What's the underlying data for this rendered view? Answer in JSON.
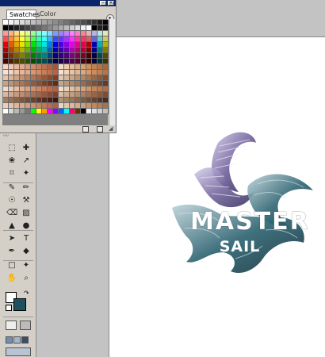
{
  "palette": {
    "tabs": [
      "Swatches",
      "Color"
    ],
    "active_tab": "Swatches",
    "titlebar_buttons": [
      "–",
      "×"
    ],
    "menu_glyph": "▸",
    "row_colors": [
      [
        "#ffffff",
        "#f2f2f2",
        "#e6e6e6",
        "#d9d9d9",
        "#cccccc",
        "#bfbfbf",
        "#b3b3b3",
        "#a6a6a6",
        "#999999",
        "#8c8c8c",
        "#808080",
        "#737373",
        "#666666",
        "#595959",
        "#4d4d4d",
        "#404040",
        "#333333",
        "#1a1a1a",
        "#000000"
      ],
      [
        "#000000",
        "#111111",
        "#222222",
        "#333333",
        "#444444",
        "#555555",
        "#666666",
        "#777777",
        "#888888",
        "#999999",
        "#aaaaaa",
        "#bbbbbb",
        "#cccccc",
        "#dddddd",
        "#eeeeee",
        "#ffffff",
        "#000000",
        "#202020",
        "#101010"
      ],
      [
        "#ff9999",
        "#ffb380",
        "#ffd980",
        "#ffff80",
        "#d9ff80",
        "#99ff99",
        "#80ffd9",
        "#80ffff",
        "#80d9ff",
        "#8099ff",
        "#9980ff",
        "#c080ff",
        "#ff80ff",
        "#ff80c0",
        "#ff8099",
        "#e6b3b3",
        "#b3b3e6",
        "#b3e6e6",
        "#e6e6b3"
      ],
      [
        "#ff4d4d",
        "#ff8c33",
        "#ffc433",
        "#ffff33",
        "#b3ff33",
        "#4dff4d",
        "#33ffb3",
        "#33ffff",
        "#33b3ff",
        "#334dff",
        "#6633ff",
        "#a633ff",
        "#ff33ff",
        "#ff33a6",
        "#ff3366",
        "#cc6666",
        "#6666cc",
        "#66cccc",
        "#cccc66"
      ],
      [
        "#e60000",
        "#e65c00",
        "#e6a800",
        "#e6e600",
        "#80e600",
        "#00e600",
        "#00e680",
        "#00e6e6",
        "#0080e6",
        "#0000e6",
        "#4d00e6",
        "#8c00e6",
        "#e600e6",
        "#e6008c",
        "#e6004d",
        "#b30000",
        "#0000b3",
        "#00b3b3",
        "#b3b300"
      ],
      [
        "#b30000",
        "#b34700",
        "#b38300",
        "#b3b300",
        "#63b300",
        "#00b300",
        "#00b363",
        "#00b3b3",
        "#0063b3",
        "#0000b3",
        "#3b00b3",
        "#6b00b3",
        "#b300b3",
        "#b3006b",
        "#b3003b",
        "#800000",
        "#000080",
        "#008080",
        "#808000"
      ],
      [
        "#800000",
        "#803300",
        "#805e00",
        "#808000",
        "#478000",
        "#008000",
        "#008047",
        "#008080",
        "#004780",
        "#000080",
        "#2b0080",
        "#4d0080",
        "#800080",
        "#80004d",
        "#80002b",
        "#4d0000",
        "#00004d",
        "#004d4d",
        "#4d4d00"
      ],
      [
        "#4d0000",
        "#4d1f00",
        "#4d3800",
        "#4d4d00",
        "#2b4d00",
        "#004d00",
        "#004d2b",
        "#004d4d",
        "#002b4d",
        "#00004d",
        "#1a004d",
        "#2e004d",
        "#4d004d",
        "#4d002e",
        "#4d001a",
        "#330000",
        "#000033",
        "#003333",
        "#333300"
      ],
      [
        "#f5d6c6",
        "#f0c8b4",
        "#e8b9a1",
        "#e0aa8e",
        "#d69b7d",
        "#cc8c6c",
        "#c27e5e",
        "#b87050",
        "#ad6344",
        "#a35639",
        "#f2dcc7",
        "#ebccb0",
        "#e3bc99",
        "#dbad84",
        "#d39e70",
        "#c9905f",
        "#bf8250",
        "#b47443",
        "#a96737"
      ],
      [
        "#fae3d3",
        "#f5d4bf",
        "#efc5ab",
        "#e9b697",
        "#e3a784",
        "#dd9872",
        "#d68a62",
        "#cf7c53",
        "#c86e45",
        "#c16139",
        "#f7e2d1",
        "#f1d3bb",
        "#ebc4a5",
        "#e5b690",
        "#dfa77c",
        "#d9996a",
        "#d28b5a",
        "#cb7e4b",
        "#c4713e"
      ],
      [
        "#e6c2a6",
        "#dbb293",
        "#d0a281",
        "#c59270",
        "#ba8360",
        "#af7451",
        "#a46643",
        "#995837",
        "#8e4b2c",
        "#833f22",
        "#e2c6ad",
        "#d6b699",
        "#caa686",
        "#be9674",
        "#b28763",
        "#a67853",
        "#9a6a45",
        "#8e5c38",
        "#824f2d"
      ],
      [
        "#c9a384",
        "#be9474",
        "#b38565",
        "#a87757",
        "#9d694a",
        "#925b3e",
        "#874e33",
        "#7c4229",
        "#713620",
        "#662b18",
        "#c4a88c",
        "#b8997c",
        "#ac8a6d",
        "#a07b5f",
        "#946d52",
        "#885f46",
        "#7c523b",
        "#704531",
        "#643928"
      ],
      [
        "#f2d9c9",
        "#eccbb6",
        "#e6bda3",
        "#e0af91",
        "#daa180",
        "#d49370",
        "#ce8561",
        "#c87853",
        "#c26b46",
        "#bc5e3a",
        "#efdfcf",
        "#e8d0ba",
        "#e1c1a6",
        "#dab292",
        "#d3a47f",
        "#cc966d",
        "#c5885c",
        "#be7a4c",
        "#b76d3e"
      ],
      [
        "#d9b8a1",
        "#cfaa91",
        "#c59c82",
        "#bb8e73",
        "#b18065",
        "#a77358",
        "#9d664c",
        "#935941",
        "#894d37",
        "#7f412e",
        "#d8bea6",
        "#cdae94",
        "#c29f83",
        "#b79073",
        "#ac8164",
        "#a17356",
        "#966649",
        "#8b593d",
        "#804c32"
      ],
      [
        "#a67c5e",
        "#9a6f52",
        "#8e6247",
        "#82563d",
        "#764a34",
        "#6a3f2c",
        "#5e3424",
        "#522a1d",
        "#462117",
        "#3a1811",
        "#b09276",
        "#a38468",
        "#96765b",
        "#89684f",
        "#7c5b44",
        "#6f4e3a",
        "#624231",
        "#553629",
        "#482b22"
      ],
      [
        "#ecd0bd",
        "#e5c3ac",
        "#dfb69c",
        "#d8a98d",
        "#d29c7e",
        "#cb9070",
        "#c58463",
        "#be7857",
        "#b86c4b",
        "#b16140",
        "#e9d4bf",
        "#e2c7ad",
        "#dbba9c",
        "#d4ad8c",
        "#cda07c",
        "#c6946e",
        "#bf8860",
        "#b87c53",
        "#b17147"
      ],
      [
        "#ffffff",
        "#d8d8d8",
        "#b8b8b8",
        "#989898",
        "#787878",
        "#00ff00",
        "#ffff00",
        "#ff9900",
        "#ff00ff",
        "#9900ff",
        "#0066ff",
        "#00ffff",
        "#ff0066",
        "#663300",
        "#000000",
        "#f0f0f0",
        "#e0e0e0",
        "#d0d0d0",
        "#c0c0c0"
      ]
    ]
  },
  "tools": {
    "glyphs": [
      "⬚",
      "✚",
      "❀",
      "↗",
      "⌑",
      "✦",
      "✎",
      "✏",
      "☉",
      "⚒",
      "⌫",
      "▨",
      "▲",
      "●",
      "➤",
      "T",
      "✒",
      "◆",
      "□",
      "✦",
      "✋",
      "⌕"
    ]
  },
  "artwork": {
    "title": "MASTER",
    "subtitle": "SAIL",
    "colors": {
      "purple": "#6e5f9a",
      "teal": "#2f6573",
      "dark_teal": "#1e3b47"
    }
  }
}
